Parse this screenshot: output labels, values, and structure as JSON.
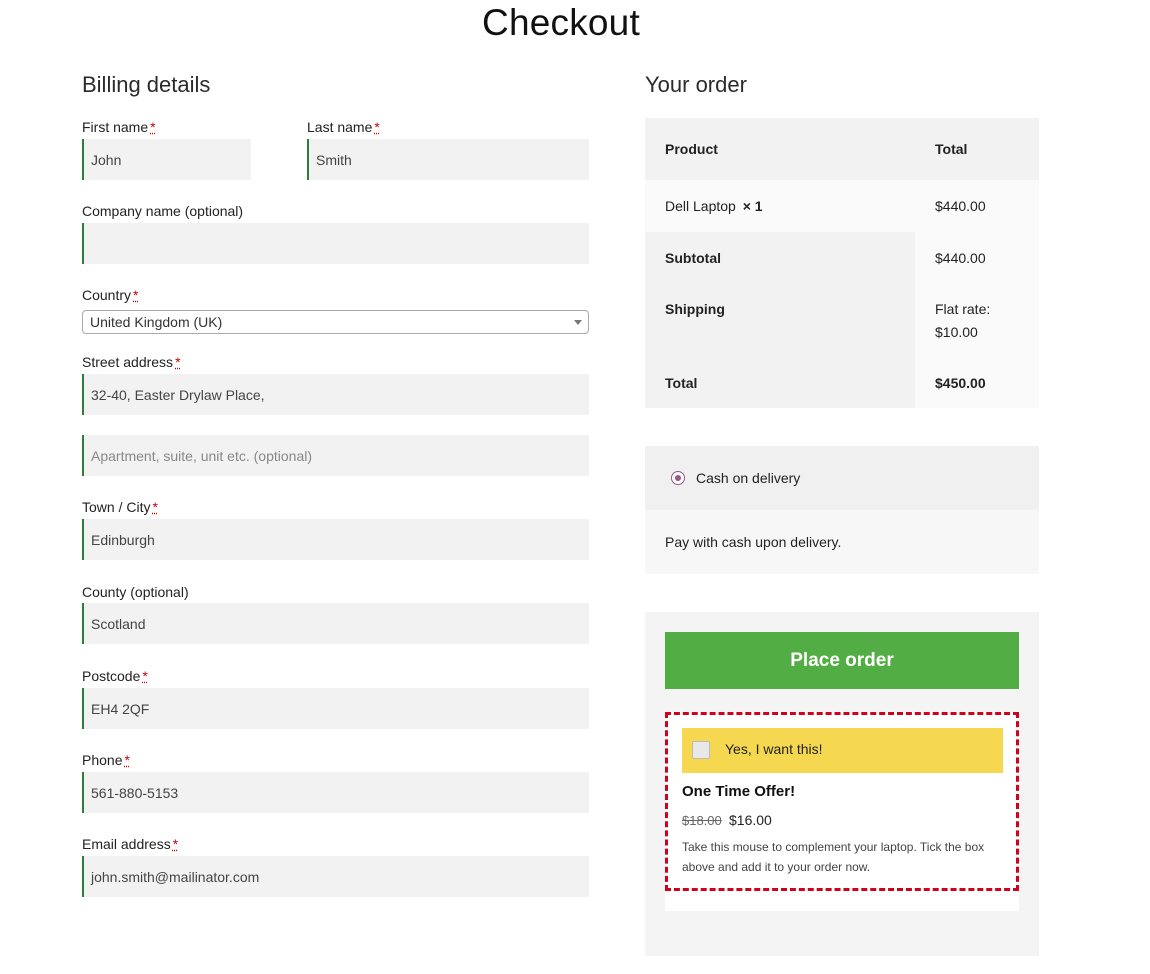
{
  "page": {
    "title": "Checkout"
  },
  "billing": {
    "heading": "Billing details",
    "first_name": {
      "label": "First name",
      "value": "John"
    },
    "last_name": {
      "label": "Last name",
      "value": "Smith"
    },
    "company": {
      "label": "Company name (optional)",
      "value": ""
    },
    "country": {
      "label": "Country",
      "value": "United Kingdom (UK)"
    },
    "street": {
      "label": "Street address",
      "value": "32-40, Easter Drylaw Place,",
      "placeholder2": "Apartment, suite, unit etc. (optional)"
    },
    "city": {
      "label": "Town / City",
      "value": "Edinburgh"
    },
    "county": {
      "label": "County (optional)",
      "value": "Scotland"
    },
    "postcode": {
      "label": "Postcode",
      "value": "EH4 2QF"
    },
    "phone": {
      "label": "Phone",
      "value": "561-880-5153"
    },
    "email": {
      "label": "Email address",
      "value": "john.smith@mailinator.com"
    },
    "required_mark": "*"
  },
  "order": {
    "heading": "Your order",
    "col_product": "Product",
    "col_total": "Total",
    "item_name": "Dell Laptop",
    "item_qty": "× 1",
    "item_total": "$440.00",
    "subtotal_label": "Subtotal",
    "subtotal_value": "$440.00",
    "shipping_label": "Shipping",
    "shipping_value_1": "Flat rate:",
    "shipping_value_2": "$10.00",
    "total_label": "Total",
    "total_value": "$450.00"
  },
  "payment": {
    "method": "Cash on delivery",
    "description": "Pay with cash upon delivery.",
    "accent_color": "#96588a"
  },
  "place_order": {
    "label": "Place order",
    "color": "#52ae44"
  },
  "offer": {
    "checkbox_label": "Yes, I want this!",
    "title": "One Time Offer!",
    "old_price": "$18.00",
    "new_price": "$16.00",
    "description": "Take this mouse to complement your laptop. Tick the box above and add it to your order now.",
    "bar_color": "#f5d84f",
    "border_color": "#d0021b"
  }
}
